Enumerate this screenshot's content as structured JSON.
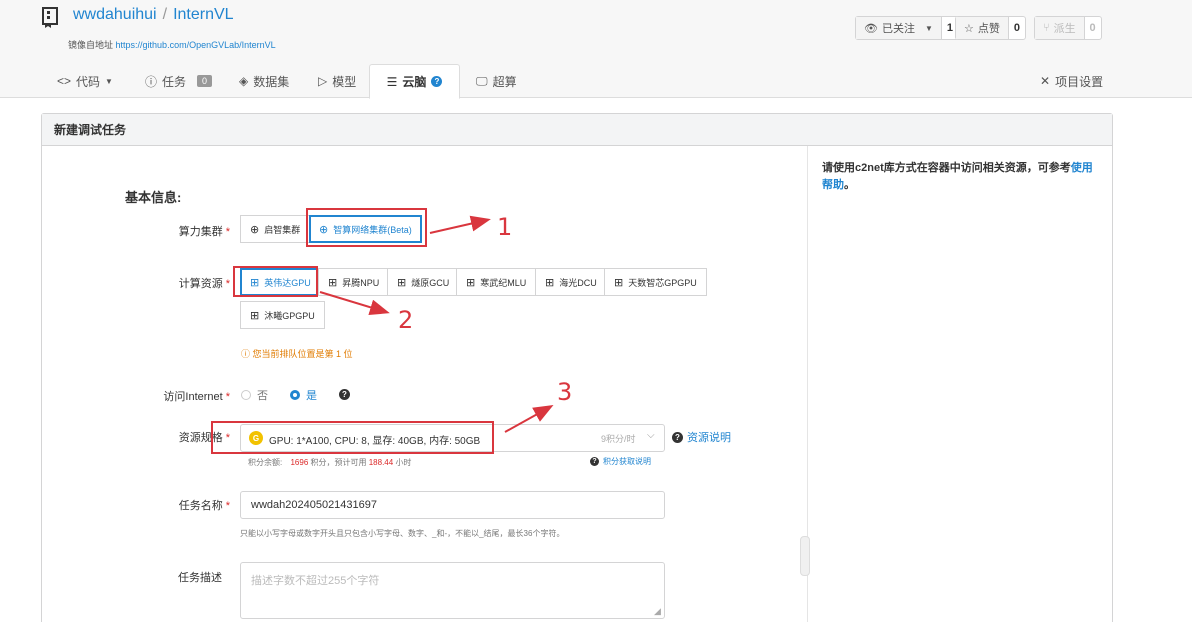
{
  "header": {
    "owner": "wwdahuihui",
    "separator": "/",
    "repo": "InternVL",
    "mirror_label": "镜像自地址",
    "mirror_url": "https://github.com/OpenGVLab/InternVL",
    "watch": {
      "label": "已关注",
      "count": "1"
    },
    "star": {
      "label": "点赞",
      "count": "0"
    },
    "fork": {
      "label": "派生",
      "count": "0"
    }
  },
  "tabs": [
    {
      "label": "代码"
    },
    {
      "label": "任务",
      "badge": "0"
    },
    {
      "label": "数据集"
    },
    {
      "label": "模型"
    },
    {
      "label": "云脑"
    },
    {
      "label": "超算"
    }
  ],
  "settings_label": "项目设置",
  "panel": {
    "title": "新建调试任务",
    "section_title": "基本信息:",
    "side_text": "请使用c2net库方式在容器中访问相关资源，可参考",
    "side_link": "使用帮助",
    "side_end": "。"
  },
  "form": {
    "cluster": {
      "label": "算力集群",
      "options": [
        "启智集群",
        "智算网络集群(Beta)"
      ],
      "selected": 1
    },
    "compute": {
      "label": "计算资源",
      "options": [
        "英伟达GPU",
        "昇腾NPU",
        "燧原GCU",
        "寒武纪MLU",
        "海光DCU",
        "天数智芯GPGPU",
        "沐曦GPGPU"
      ],
      "selected": 0,
      "queue_notice": "您当前排队位置是第 1 位"
    },
    "internet": {
      "label": "访问Internet",
      "options": [
        "否",
        "是"
      ],
      "selected": 1
    },
    "spec": {
      "label": "资源规格",
      "badge": "G",
      "value": "GPU: 1*A100, CPU: 8, 显存: 40GB, 内存: 50GB",
      "price": "9积分/时",
      "help_link": "资源说明",
      "balance_label": "积分余额:",
      "balance": "1696",
      "balance_unit": "积分，预计可用",
      "hours": "188.44",
      "hours_unit": "小时",
      "earn_link": "积分获取说明"
    },
    "task_name": {
      "label": "任务名称",
      "value": "wwdah202405021431697",
      "hint": "只能以小写字母或数字开头且只包含小写字母、数字、_和-，不能以_结尾，最长36个字符。"
    },
    "task_desc": {
      "label": "任务描述",
      "placeholder": "描述字数不超过255个字符"
    }
  },
  "annotations": [
    "1",
    "2",
    "3"
  ],
  "colors": {
    "accent": "#2185d0",
    "annotation": "#d9363e",
    "warning": "#e07b00",
    "required": "#db2828"
  }
}
